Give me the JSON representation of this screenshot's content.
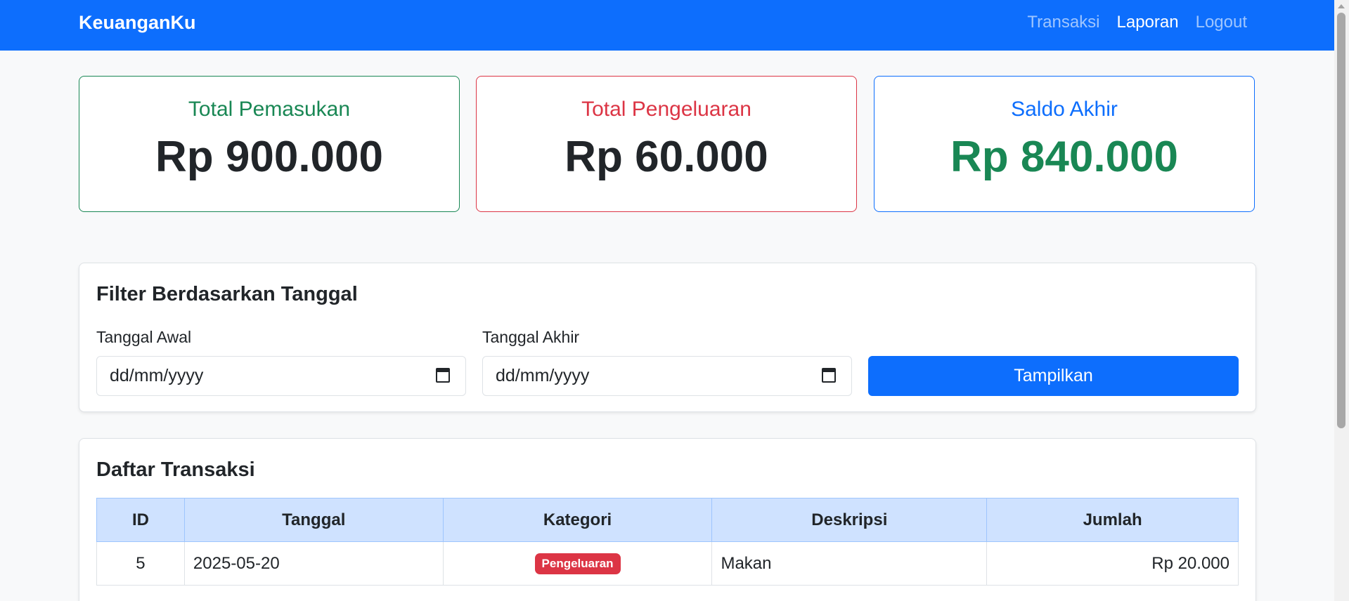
{
  "navbar": {
    "brand": "KeuanganKu",
    "links": [
      {
        "label": "Transaksi"
      },
      {
        "label": "Laporan"
      },
      {
        "label": "Logout"
      }
    ]
  },
  "summary": {
    "income": {
      "title": "Total Pemasukan",
      "value": "Rp 900.000"
    },
    "expense": {
      "title": "Total Pengeluaran",
      "value": "Rp 60.000"
    },
    "balance": {
      "title": "Saldo Akhir",
      "value": "Rp 840.000"
    }
  },
  "filter": {
    "title": "Filter Berdasarkan Tanggal",
    "start_label": "Tanggal Awal",
    "start_placeholder": "dd/mm/yyyy",
    "end_label": "Tanggal Akhir",
    "end_placeholder": "dd/mm/yyyy",
    "submit_label": "Tampilkan"
  },
  "transactions": {
    "title": "Daftar Transaksi",
    "columns": [
      "ID",
      "Tanggal",
      "Kategori",
      "Deskripsi",
      "Jumlah"
    ],
    "rows": [
      {
        "id": "5",
        "date": "2025-05-20",
        "category": "Pengeluaran",
        "description": "Makan",
        "amount": "Rp 20.000"
      }
    ]
  },
  "colors": {
    "primary": "#0d6efd",
    "success": "#198754",
    "danger": "#dc3545",
    "table_header": "#cfe2ff"
  }
}
